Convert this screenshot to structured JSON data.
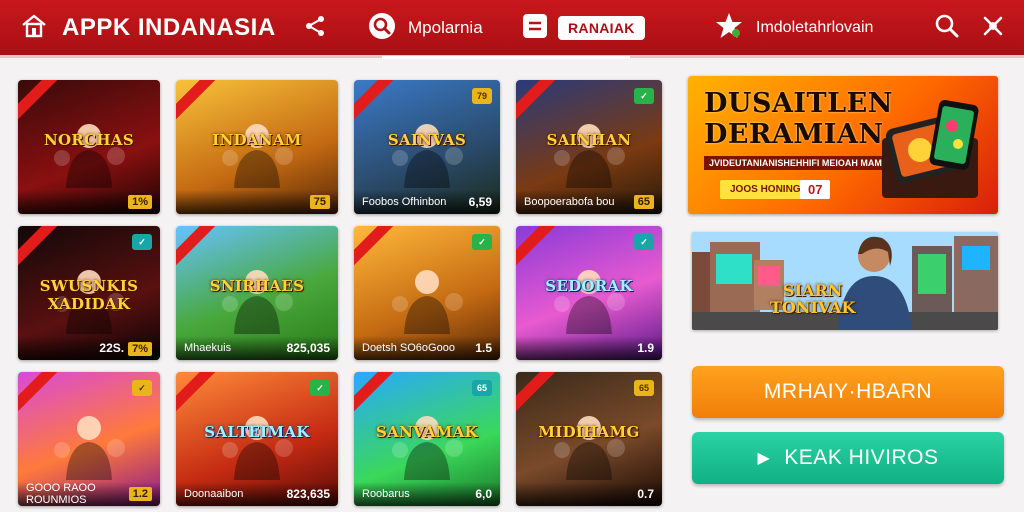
{
  "header": {
    "brand": "APPK INDANASIA",
    "nav1_label": "Mpolarnia",
    "nav2_label": "RANAIAK",
    "nav3_label": "Imdoletahrlovain"
  },
  "cards": [
    {
      "title": "NORCHAS",
      "footer_text": "",
      "footer_value": "",
      "badge": "1%",
      "corner": ""
    },
    {
      "title": "INDANAM",
      "footer_text": "",
      "footer_value": "",
      "badge": "75",
      "corner": ""
    },
    {
      "title": "SAINVAS",
      "footer_text": "Foobos Ofhinbon",
      "footer_value": "6,59",
      "badge": "",
      "corner": "79"
    },
    {
      "title": "SAINHAN",
      "footer_text": "Boopoerabofa bou",
      "footer_value": "",
      "badge": "65",
      "corner": "✓"
    },
    {
      "title": "SWUSNKIS XADIDAK",
      "footer_text": "",
      "footer_value": "22S.",
      "badge": "7%",
      "corner": "✓"
    },
    {
      "title": "SNIRHAES",
      "footer_text": "Mhaekuis",
      "footer_value": "825,035",
      "badge": "",
      "corner": ""
    },
    {
      "title": "",
      "footer_text": "Doetsh SO6oGooo",
      "footer_value": "1.5",
      "badge": "",
      "corner": "✓"
    },
    {
      "title": "SEDORAK",
      "footer_text": "",
      "footer_value": "1.9",
      "badge": "",
      "corner": "✓"
    },
    {
      "title": "",
      "footer_text": "GOOO RAOO ROUNMIOS",
      "footer_value": "",
      "badge": "1.2",
      "corner": "✓"
    },
    {
      "title": "SALTEIMAK",
      "footer_text": "Doonaaibon",
      "footer_value": "823,635",
      "badge": "",
      "corner": "✓"
    },
    {
      "title": "SANVAMAK",
      "footer_text": "Roobarus",
      "footer_value": "6,0",
      "badge": "",
      "corner": "65"
    },
    {
      "title": "MIDIHAMG",
      "footer_text": "",
      "footer_value": "0.7",
      "badge": "",
      "corner": "65"
    }
  ],
  "promo1": {
    "headline_1": "DUSAITLEN",
    "headline_2": "DERAMIAN",
    "subline": "JVIDEUTANIANISHEHHIFI MEIOAH MAMEN",
    "cta": "JOOS HONINGE",
    "badge": "07"
  },
  "promo2": {
    "headline_1": "SIARN",
    "headline_2": "TONIVAK"
  },
  "buttons": {
    "primary": "MRHAIY·HBARN",
    "secondary": "KEAK HIVIROS"
  },
  "colors": {
    "header": "#b5131a",
    "primary_button": "#f58e12",
    "secondary_button": "#1ec194"
  }
}
